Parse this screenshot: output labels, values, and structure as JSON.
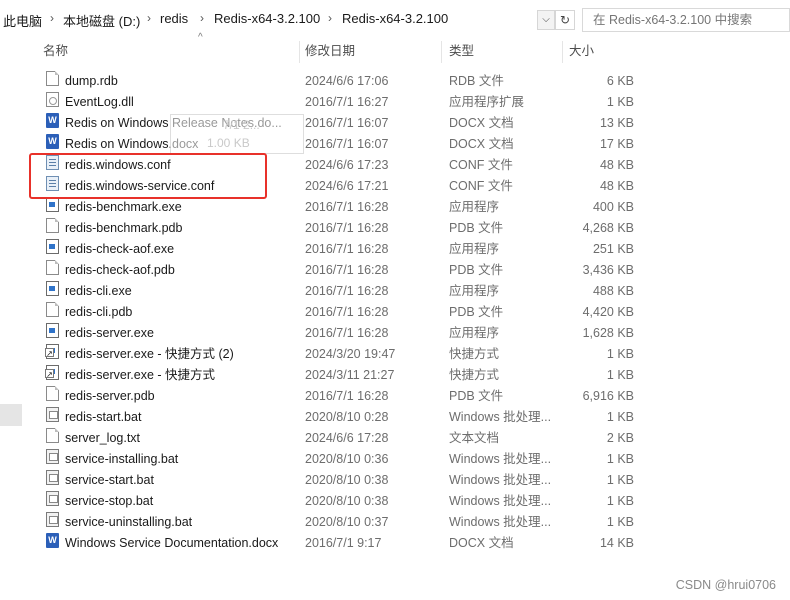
{
  "address_bar": {
    "crumbs": [
      "此电脑",
      "本地磁盘 (D:)",
      "redis",
      "Redis-x64-3.2.100",
      "Redis-x64-3.2.100"
    ],
    "search_placeholder": "在 Redis-x64-3.2.100 中搜索"
  },
  "columns": {
    "name": "名称",
    "date": "修改日期",
    "type": "类型",
    "size": "大小"
  },
  "files": [
    {
      "name": "dump.rdb",
      "date": "2024/6/6 17:06",
      "type": "RDB 文件",
      "size": "6 KB",
      "icon": "doc"
    },
    {
      "name": "EventLog.dll",
      "date": "2016/7/1 16:27",
      "type": "应用程序扩展",
      "size": "1 KB",
      "icon": "dll"
    },
    {
      "name": "Redis on Windows Release Notes.do...",
      "date": "2016/7/1 16:07",
      "type": "DOCX 文档",
      "size": "13 KB",
      "icon": "word"
    },
    {
      "name": "Redis on Windows.docx",
      "date": "2016/7/1 16:07",
      "type": "DOCX 文档",
      "size": "17 KB",
      "icon": "word"
    },
    {
      "name": "redis.windows.conf",
      "date": "2024/6/6 17:23",
      "type": "CONF 文件",
      "size": "48 KB",
      "icon": "conf"
    },
    {
      "name": "redis.windows-service.conf",
      "date": "2024/6/6 17:21",
      "type": "CONF 文件",
      "size": "48 KB",
      "icon": "conf"
    },
    {
      "name": "redis-benchmark.exe",
      "date": "2016/7/1 16:28",
      "type": "应用程序",
      "size": "400 KB",
      "icon": "exe"
    },
    {
      "name": "redis-benchmark.pdb",
      "date": "2016/7/1 16:28",
      "type": "PDB 文件",
      "size": "4,268 KB",
      "icon": "doc"
    },
    {
      "name": "redis-check-aof.exe",
      "date": "2016/7/1 16:28",
      "type": "应用程序",
      "size": "251 KB",
      "icon": "exe"
    },
    {
      "name": "redis-check-aof.pdb",
      "date": "2016/7/1 16:28",
      "type": "PDB 文件",
      "size": "3,436 KB",
      "icon": "doc"
    },
    {
      "name": "redis-cli.exe",
      "date": "2016/7/1 16:28",
      "type": "应用程序",
      "size": "488 KB",
      "icon": "exe"
    },
    {
      "name": "redis-cli.pdb",
      "date": "2016/7/1 16:28",
      "type": "PDB 文件",
      "size": "4,420 KB",
      "icon": "doc"
    },
    {
      "name": "redis-server.exe",
      "date": "2016/7/1 16:28",
      "type": "应用程序",
      "size": "1,628 KB",
      "icon": "exe"
    },
    {
      "name": "redis-server.exe - 快捷方式 (2)",
      "date": "2024/3/20 19:47",
      "type": "快捷方式",
      "size": "1 KB",
      "icon": "lnk"
    },
    {
      "name": "redis-server.exe - 快捷方式",
      "date": "2024/3/11 21:27",
      "type": "快捷方式",
      "size": "1 KB",
      "icon": "lnk"
    },
    {
      "name": "redis-server.pdb",
      "date": "2016/7/1 16:28",
      "type": "PDB 文件",
      "size": "6,916 KB",
      "icon": "doc"
    },
    {
      "name": "redis-start.bat",
      "date": "2020/8/10 0:28",
      "type": "Windows 批处理...",
      "size": "1 KB",
      "icon": "bat"
    },
    {
      "name": "server_log.txt",
      "date": "2024/6/6 17:28",
      "type": "文本文档",
      "size": "2 KB",
      "icon": "doc"
    },
    {
      "name": "service-installing.bat",
      "date": "2020/8/10 0:36",
      "type": "Windows 批处理...",
      "size": "1 KB",
      "icon": "bat"
    },
    {
      "name": "service-start.bat",
      "date": "2020/8/10 0:38",
      "type": "Windows 批处理...",
      "size": "1 KB",
      "icon": "bat"
    },
    {
      "name": "service-stop.bat",
      "date": "2020/8/10 0:38",
      "type": "Windows 批处理...",
      "size": "1 KB",
      "icon": "bat"
    },
    {
      "name": "service-uninstalling.bat",
      "date": "2020/8/10 0:37",
      "type": "Windows 批处理...",
      "size": "1 KB",
      "icon": "bat"
    },
    {
      "name": "Windows Service Documentation.docx",
      "date": "2016/7/1 9:17",
      "type": "DOCX 文档",
      "size": "14 KB",
      "icon": "word"
    }
  ],
  "tooltip_ghost": {
    "line1": "7/1 2...",
    "line2": "1.00 KB"
  },
  "highlight_color": "#e8312a",
  "watermark": "CSDN @hrui0706"
}
